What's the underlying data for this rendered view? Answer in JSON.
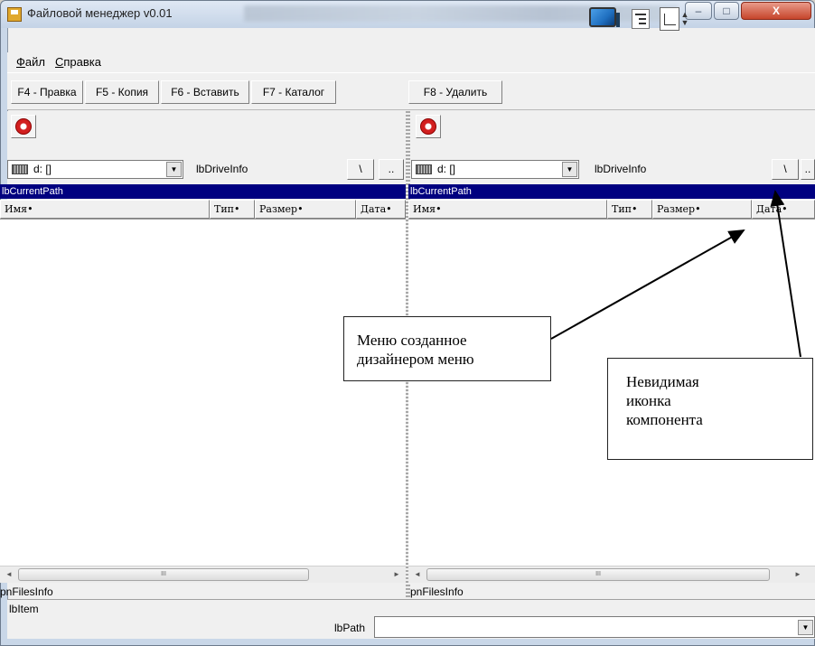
{
  "window": {
    "title": "Файловой менеджер v0.01",
    "controls": [
      "–",
      "□",
      "X"
    ]
  },
  "menu": {
    "items": [
      {
        "accel": "Ф",
        "rest": "айл"
      },
      {
        "accel": "С",
        "rest": "правка"
      }
    ]
  },
  "toolbar": {
    "buttons": [
      "F4 - Правка",
      "F5 - Копия",
      "F6 - Вставить",
      "F7 - Каталог",
      "F8 - Удалить"
    ],
    "icons": [
      "monitor-icon",
      "tree-view-icon",
      "split-view-icon",
      "spin-arrows-icon"
    ]
  },
  "panels": {
    "left": {
      "drive": "d: []",
      "drive_info": "lbDriveInfo",
      "root_btn": "\\",
      "up_btn": "..",
      "path": "lbCurrentPath",
      "columns": [
        "Имя•",
        "Тип•",
        "Размер•",
        "Дата•"
      ],
      "files_info": "pnFilesInfo",
      "scroll_grip": "III"
    },
    "right": {
      "drive": "d: []",
      "drive_info": "lbDriveInfo",
      "root_btn": "\\",
      "up_btn": "..",
      "path": "lbCurrentPath",
      "columns": [
        "Имя•",
        "Тип•",
        "Размер•",
        "Дата•"
      ],
      "files_info": "pnFilesInfo",
      "scroll_grip": "III"
    }
  },
  "status": {
    "item": "lbItem",
    "path_label": "lbPath",
    "path_value": ""
  },
  "callouts": {
    "menu_designer": [
      "Меню созданное",
      "дизайнером меню"
    ],
    "invisible_icon": [
      "Невидимая",
      "иконка",
      "компонента"
    ]
  },
  "colors": {
    "path_bar": "#000080",
    "close_button": "#c6452b",
    "window_frame": "#c9d7e8"
  }
}
